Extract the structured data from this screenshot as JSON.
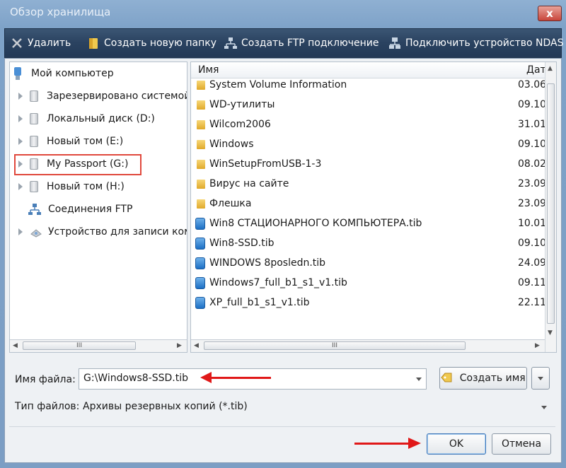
{
  "window": {
    "title": "Обзор хранилища",
    "close_label": "x"
  },
  "toolbar": {
    "delete_label": "Удалить",
    "new_folder_label": "Создать новую папку",
    "ftp_label": "Создать FTP подключение",
    "nas_label": "Подключить устройство NDAS"
  },
  "tree": {
    "root_label": "Мой компьютер",
    "items": [
      {
        "label": "Зарезервировано системой"
      },
      {
        "label": "Локальный диск (D:)"
      },
      {
        "label": "Новый том (E:)"
      },
      {
        "label": "My Passport (G:)"
      },
      {
        "label": "Новый том (H:)"
      },
      {
        "label": "Соединения FTP"
      },
      {
        "label": "Устройство для записи компакт-дисков"
      }
    ],
    "scroll_grip": "III"
  },
  "files": {
    "col_name": "Имя",
    "col_date": "Дат:",
    "rows": [
      {
        "name": "System Volume Information",
        "date": "03.06",
        "type": "folder"
      },
      {
        "name": "WD-утилиты",
        "date": "09.10",
        "type": "folder"
      },
      {
        "name": "Wilcom2006",
        "date": "31.01",
        "type": "folder"
      },
      {
        "name": "Windows",
        "date": "09.10",
        "type": "folder"
      },
      {
        "name": "WinSetupFromUSB-1-3",
        "date": "08.02",
        "type": "folder"
      },
      {
        "name": "Вирус на сайте",
        "date": "23.09",
        "type": "folder"
      },
      {
        "name": "Флешка",
        "date": "23.09",
        "type": "folder"
      },
      {
        "name": "Win8 СТАЦИОНАРНОГО КОМПЬЮТЕРА.tib",
        "date": "10.01",
        "type": "tib"
      },
      {
        "name": "Win8-SSD.tib",
        "date": "09.10",
        "type": "tib"
      },
      {
        "name": "WINDOWS 8posledn.tib",
        "date": "24.09",
        "type": "tib"
      },
      {
        "name": "Windows7_full_b1_s1_v1.tib",
        "date": "09.11",
        "type": "tib"
      },
      {
        "name": "XP_full_b1_s1_v1.tib",
        "date": "22.11",
        "type": "tib"
      }
    ],
    "scroll_grip": "III"
  },
  "filename": {
    "label": "Имя файла:",
    "value": "G:\\Windows8-SSD.tib",
    "create_name_label": "Создать имя"
  },
  "filetype": {
    "label": "Тип файлов:",
    "value": "Архивы резервных копий (*.tib)"
  },
  "buttons": {
    "ok_label": "OK",
    "cancel_label": "Отмена"
  },
  "colors": {
    "highlight": "#e0483c",
    "annotation_arrow": "#e01818",
    "toolbar_bg": "#2a4260"
  }
}
